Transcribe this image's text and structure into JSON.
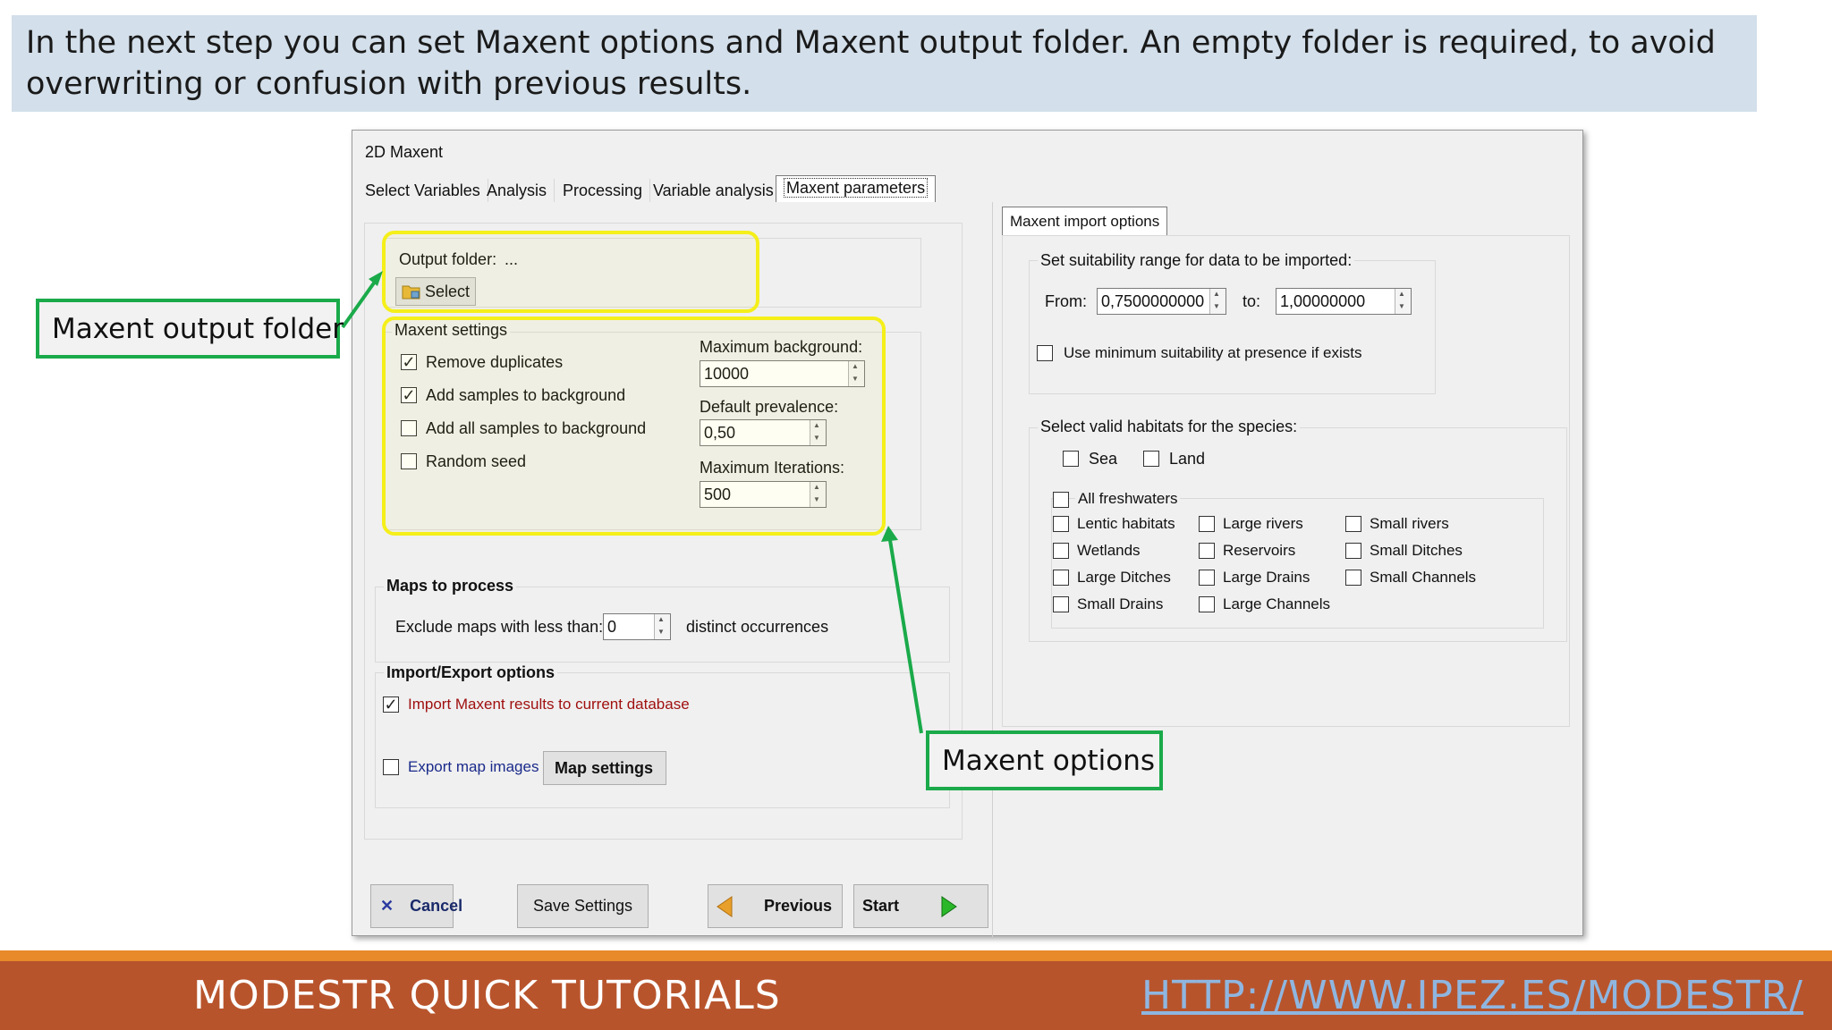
{
  "banner": {
    "text": "In the next step you can set Maxent options and Maxent output folder. An empty folder is required, to avoid overwriting or confusion with previous results."
  },
  "window": {
    "title": "2D Maxent",
    "tabs": [
      {
        "label": "Select Variables",
        "active": false
      },
      {
        "label": "Analysis",
        "active": false
      },
      {
        "label": "Processing",
        "active": false
      },
      {
        "label": "Variable analysis",
        "active": false
      },
      {
        "label": "Maxent parameters",
        "active": true
      }
    ],
    "output": {
      "label": "Output folder:",
      "value": "...",
      "select_label": "Select"
    },
    "maxent_settings": {
      "legend": "Maxent settings",
      "checkboxes": [
        {
          "label": "Remove duplicates",
          "checked": true
        },
        {
          "label": "Add samples to background",
          "checked": true
        },
        {
          "label": "Add all samples to background",
          "checked": false
        },
        {
          "label": "Random seed",
          "checked": false
        }
      ],
      "max_background_label": "Maximum background:",
      "max_background": "10000",
      "default_prevalence_label": "Default prevalence:",
      "default_prevalence": "0,50",
      "max_iterations_label": "Maximum Iterations:",
      "max_iterations": "500"
    },
    "maps_to_process": {
      "legend": "Maps to process",
      "exclude_label": "Exclude maps with less than:",
      "exclude_value": "0",
      "suffix": "distinct occurrences"
    },
    "import_export": {
      "legend": "Import/Export options",
      "import_label": "Import Maxent results to current database",
      "import_checked": true,
      "export_label": "Export map images",
      "export_checked": false,
      "map_settings_label": "Map settings"
    },
    "import_options": {
      "tab_label": "Maxent import options",
      "range_legend": "Set suitability range for data to be imported:",
      "from_label": "From:",
      "from_value": "0,7500000000",
      "to_label": "to:",
      "to_value": "1,00000000",
      "min_suit_label": "Use minimum suitability at presence if exists",
      "habitats_legend": "Select valid habitats for the species:",
      "sea_label": "Sea",
      "land_label": "Land",
      "all_fresh_label": "All freshwaters",
      "habitats": [
        "Lentic habitats",
        "Large rivers",
        "Small rivers",
        "Wetlands",
        "Reservoirs",
        "Small Ditches",
        "Large Ditches",
        "Large Drains",
        "Small Channels",
        "Small Drains",
        "Large Channels"
      ]
    },
    "buttons": {
      "cancel": "Cancel",
      "save": "Save Settings",
      "previous": "Previous",
      "start": "Start"
    }
  },
  "callouts": {
    "output_folder": "Maxent output folder",
    "options": "Maxent options"
  },
  "footer": {
    "title": "MODESTR QUICK TUTORIALS",
    "link": "HTTP://WWW.IPEZ.ES/MODESTR/"
  },
  "colors": {
    "highlight": "#f5ef1a",
    "callout_border": "#1aaa4a",
    "footer_bg": "#b8542c",
    "footer_stripe": "#e8892a",
    "banner_bg": "#d3dfea",
    "import_text": "#a01010",
    "export_text": "#1a2a8a"
  }
}
